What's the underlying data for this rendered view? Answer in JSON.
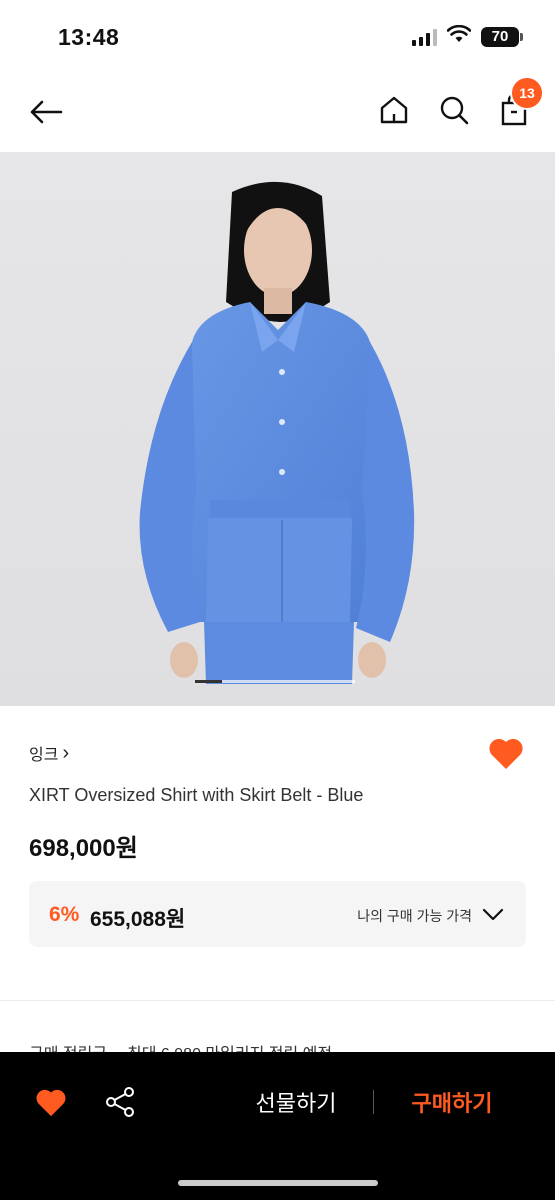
{
  "status_bar": {
    "time": "13:48",
    "battery": "70"
  },
  "header": {
    "cart_count": "13"
  },
  "product_image": {
    "alt": "model wearing blue oversized shirt with skirt belt",
    "image_index": 1,
    "image_total": 6
  },
  "product": {
    "brand": "잉크",
    "brand_chevron": "›",
    "name": "XIRT Oversized Shirt with Skirt Belt - Blue",
    "price": "698,000원",
    "liked": true
  },
  "member_price": {
    "discount": "6%",
    "price": "655,088원",
    "label": "나의 구매 가능 가격"
  },
  "points": {
    "label": "구매 적립금",
    "value": "최대 6,980 마일리지 적립 예정"
  },
  "bottom_bar": {
    "gift_label": "선물하기",
    "buy_label": "구매하기"
  },
  "colors": {
    "accent": "#ff5a1f",
    "shirt_blue": "#5f8fe0"
  }
}
